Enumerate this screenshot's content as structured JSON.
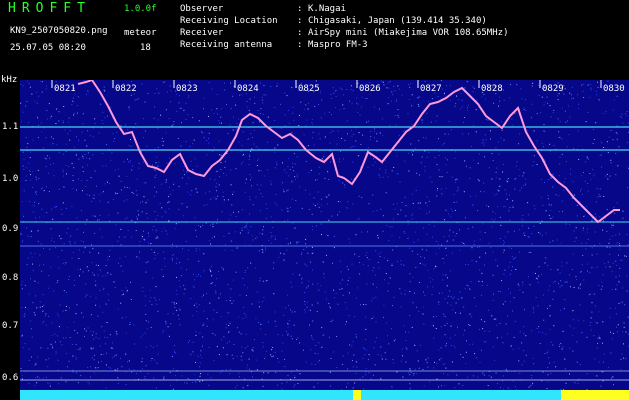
{
  "header": {
    "app_title": "HROFFT",
    "version": "1.0.0f",
    "filename": "KN9_2507050820.png",
    "datetime": "25.07.05 08:20",
    "meteor_label": "meteor",
    "meteor_count": "18"
  },
  "info": [
    {
      "key": "Observer",
      "value": "K.Nagai"
    },
    {
      "key": "Receiving Location",
      "value": "Chigasaki, Japan (139.414 35.340)"
    },
    {
      "key": "Receiver",
      "value": "AirSpy mini (Miakejima VOR 108.65MHz)"
    },
    {
      "key": "Receiving antenna",
      "value": "Maspro FM-3"
    }
  ],
  "axis": {
    "y_unit": "kHz",
    "y_ticks": [
      "1.1",
      "1.0",
      "0.9",
      "0.8",
      "0.7",
      "0.6"
    ],
    "time_ticks": [
      "0821",
      "0822",
      "0823",
      "0824",
      "0825",
      "0826",
      "0827",
      "0828",
      "0829",
      "0830"
    ]
  },
  "colors": {
    "background": "#07078a",
    "trace": "#ff9ad8",
    "line": "#45d8f0",
    "bar": "#30e6ff",
    "burst": "#ffff20",
    "title": "#2bff2b"
  }
}
